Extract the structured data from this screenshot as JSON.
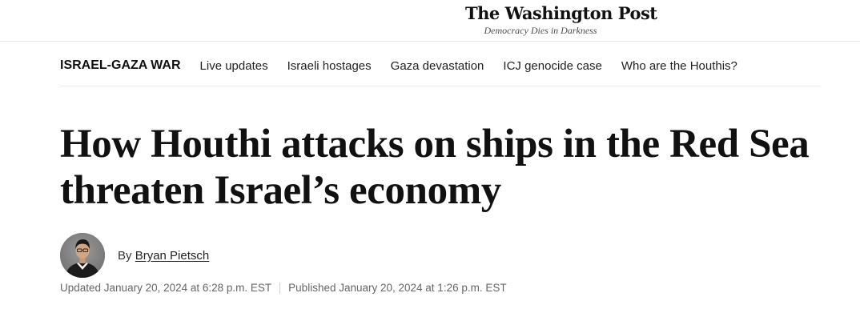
{
  "masthead": {
    "logo_text": "The Washington Post",
    "tagline": "Democracy Dies in Darkness"
  },
  "subnav": {
    "section_title": "ISRAEL-GAZA WAR",
    "links": [
      "Live updates",
      "Israeli hostages",
      "Gaza devastation",
      "ICJ genocide case",
      "Who are the Houthis?"
    ]
  },
  "article": {
    "headline": "How Houthi attacks on ships in the Red Sea threaten Israel’s economy",
    "byline_prefix": "By",
    "author": "Bryan Pietsch",
    "updated": "Updated January 20, 2024 at 6:28 p.m. EST",
    "published": "Published January 20, 2024 at 1:26 p.m. EST"
  },
  "colors": {
    "text": "#111111",
    "muted": "#666666",
    "divider": "#e6e6e6"
  }
}
